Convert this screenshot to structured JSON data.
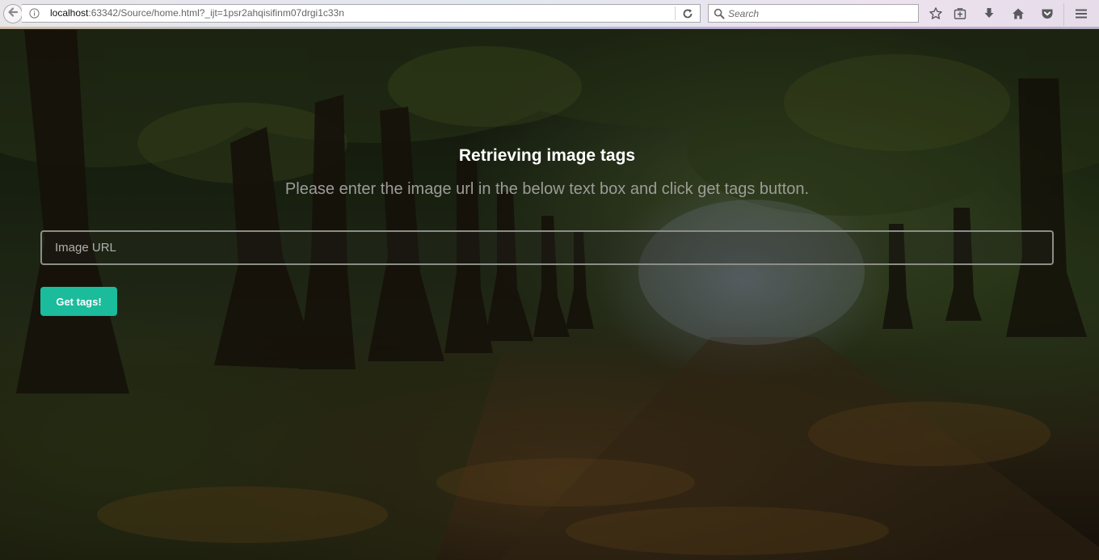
{
  "browser": {
    "url_host": "localhost",
    "url_rest": ":63342/Source/home.html?_ijt=1psr2ahqisifinm07drgi1c33n",
    "search_placeholder": "Search",
    "icons": [
      "back-arrow-icon",
      "info-icon",
      "reload-icon",
      "search-icon",
      "bookmark-star-icon",
      "reading-list-icon",
      "download-icon",
      "home-icon",
      "pocket-icon",
      "menu-icon"
    ]
  },
  "page": {
    "title": "Retrieving image tags",
    "subtitle": "Please enter the image url in the below text box and click get tags button.",
    "input_placeholder": "Image URL",
    "input_value": "",
    "button_label": "Get tags!"
  },
  "colors": {
    "accent": "#1abc9c",
    "title": "#ffffff",
    "subtitle": "#9c9c98"
  }
}
